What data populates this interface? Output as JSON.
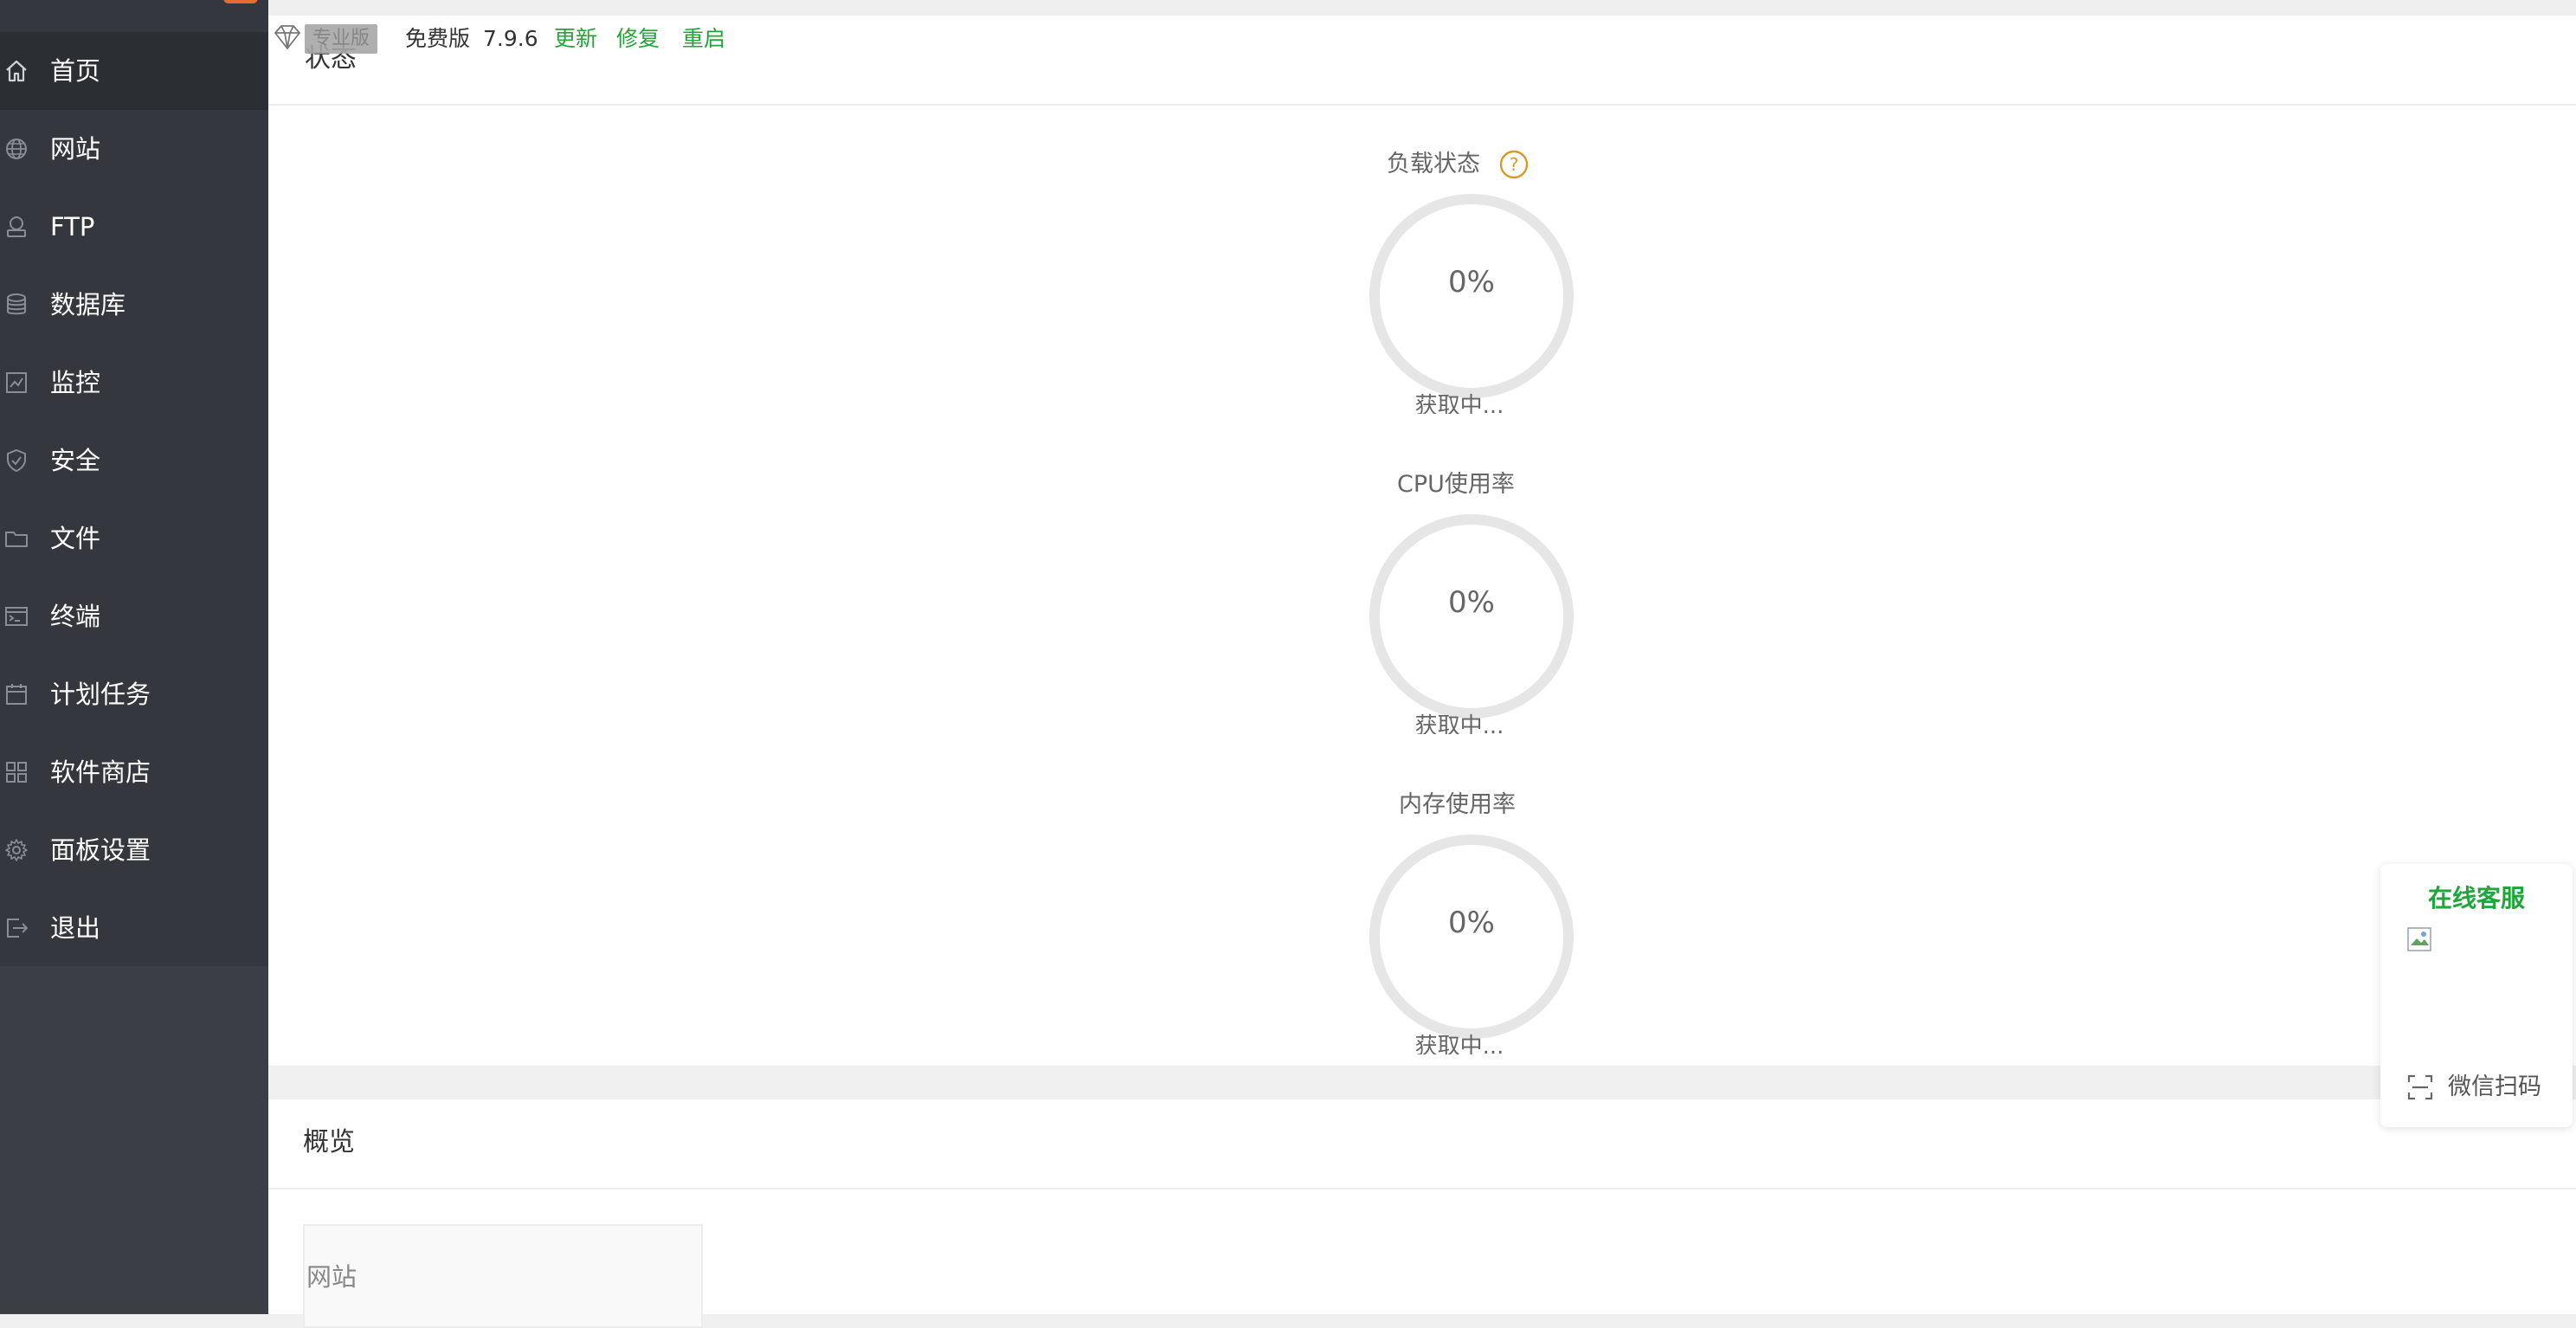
{
  "sidebar": {
    "items": [
      {
        "label": "首页",
        "icon": "home-icon",
        "active": true
      },
      {
        "label": "网站",
        "icon": "globe-icon"
      },
      {
        "label": "FTP",
        "icon": "ftp-icon"
      },
      {
        "label": "数据库",
        "icon": "database-icon"
      },
      {
        "label": "监控",
        "icon": "monitor-chart-icon"
      },
      {
        "label": "安全",
        "icon": "shield-icon"
      },
      {
        "label": "文件",
        "icon": "folder-icon"
      },
      {
        "label": "终端",
        "icon": "terminal-icon"
      },
      {
        "label": "计划任务",
        "icon": "calendar-icon"
      },
      {
        "label": "软件商店",
        "icon": "grid-apps-icon"
      },
      {
        "label": "面板设置",
        "icon": "gear-icon"
      },
      {
        "label": "退出",
        "icon": "logout-icon"
      }
    ]
  },
  "topbar": {
    "pro_badge": "专业版",
    "edition": "免费版",
    "version": "7.9.6",
    "update": "更新",
    "repair": "修复",
    "restart": "重启"
  },
  "status_panel": {
    "title": "状态",
    "gauges": [
      {
        "title": "负载状态",
        "value": "0%",
        "status": "获取中...",
        "has_help": true
      },
      {
        "title": "CPU使用率",
        "value": "0%",
        "status": "获取中..."
      },
      {
        "title": "内存使用率",
        "value": "0%",
        "status": "获取中..."
      }
    ]
  },
  "overview_panel": {
    "title": "概览",
    "card_label": "网站"
  },
  "service_widget": {
    "title": "在线客服",
    "scan_label": "微信扫码"
  },
  "colors": {
    "sidebar_bg": "#3b3f45",
    "sidebar_active": "#2b2f34",
    "accent_green": "#20a53a",
    "badge_orange": "#e86a35",
    "help_orange": "#d89a2a",
    "gauge_ring": "#e6e6e6"
  }
}
